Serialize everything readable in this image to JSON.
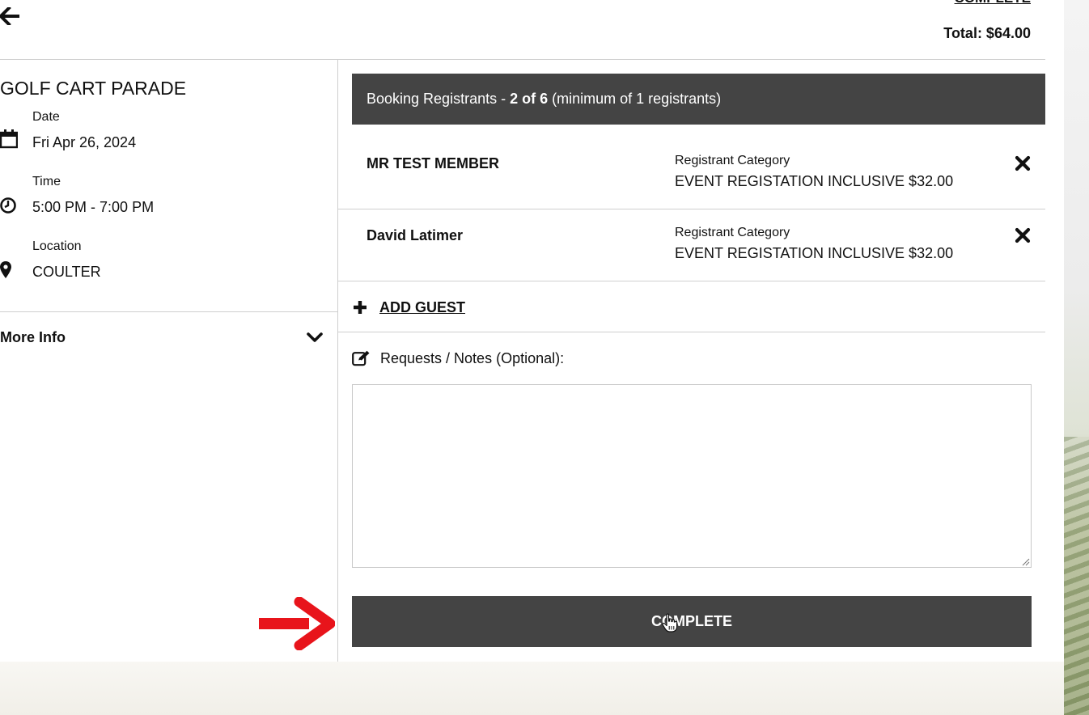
{
  "header": {
    "back_icon": "arrow-left-icon",
    "top_complete_link": "COMPLETE",
    "total": "Total: $64.00"
  },
  "event": {
    "title": "GOLF CART PARADE",
    "date_label": "Date",
    "date_value": "Fri Apr 26, 2024",
    "time_label": "Time",
    "time_value": "5:00 PM - 7:00 PM",
    "location_label": "Location",
    "location_value": "COULTER",
    "icons": [
      "calendar-icon",
      "clock-icon",
      "map-pin-icon"
    ],
    "more_info": "More Info"
  },
  "registrants": {
    "header_prefix": "Booking Registrants - ",
    "header_count": "2 of 6",
    "header_suffix": " (minimum of 1 registrants)",
    "rows": [
      {
        "name": "MR TEST MEMBER",
        "category_label": "Registrant Category",
        "category_value": "EVENT REGISTATION INCLUSIVE $32.00"
      },
      {
        "name": "David Latimer",
        "category_label": "Registrant Category",
        "category_value": "EVENT REGISTATION INCLUSIVE $32.00"
      }
    ]
  },
  "add_guest": "ADD GUEST",
  "notes": {
    "label": "Requests / Notes (Optional):",
    "value": ""
  },
  "complete_button": "COMPLETE",
  "colors": {
    "dark_bar": "#444444",
    "annotation_arrow": "#e8141b"
  }
}
